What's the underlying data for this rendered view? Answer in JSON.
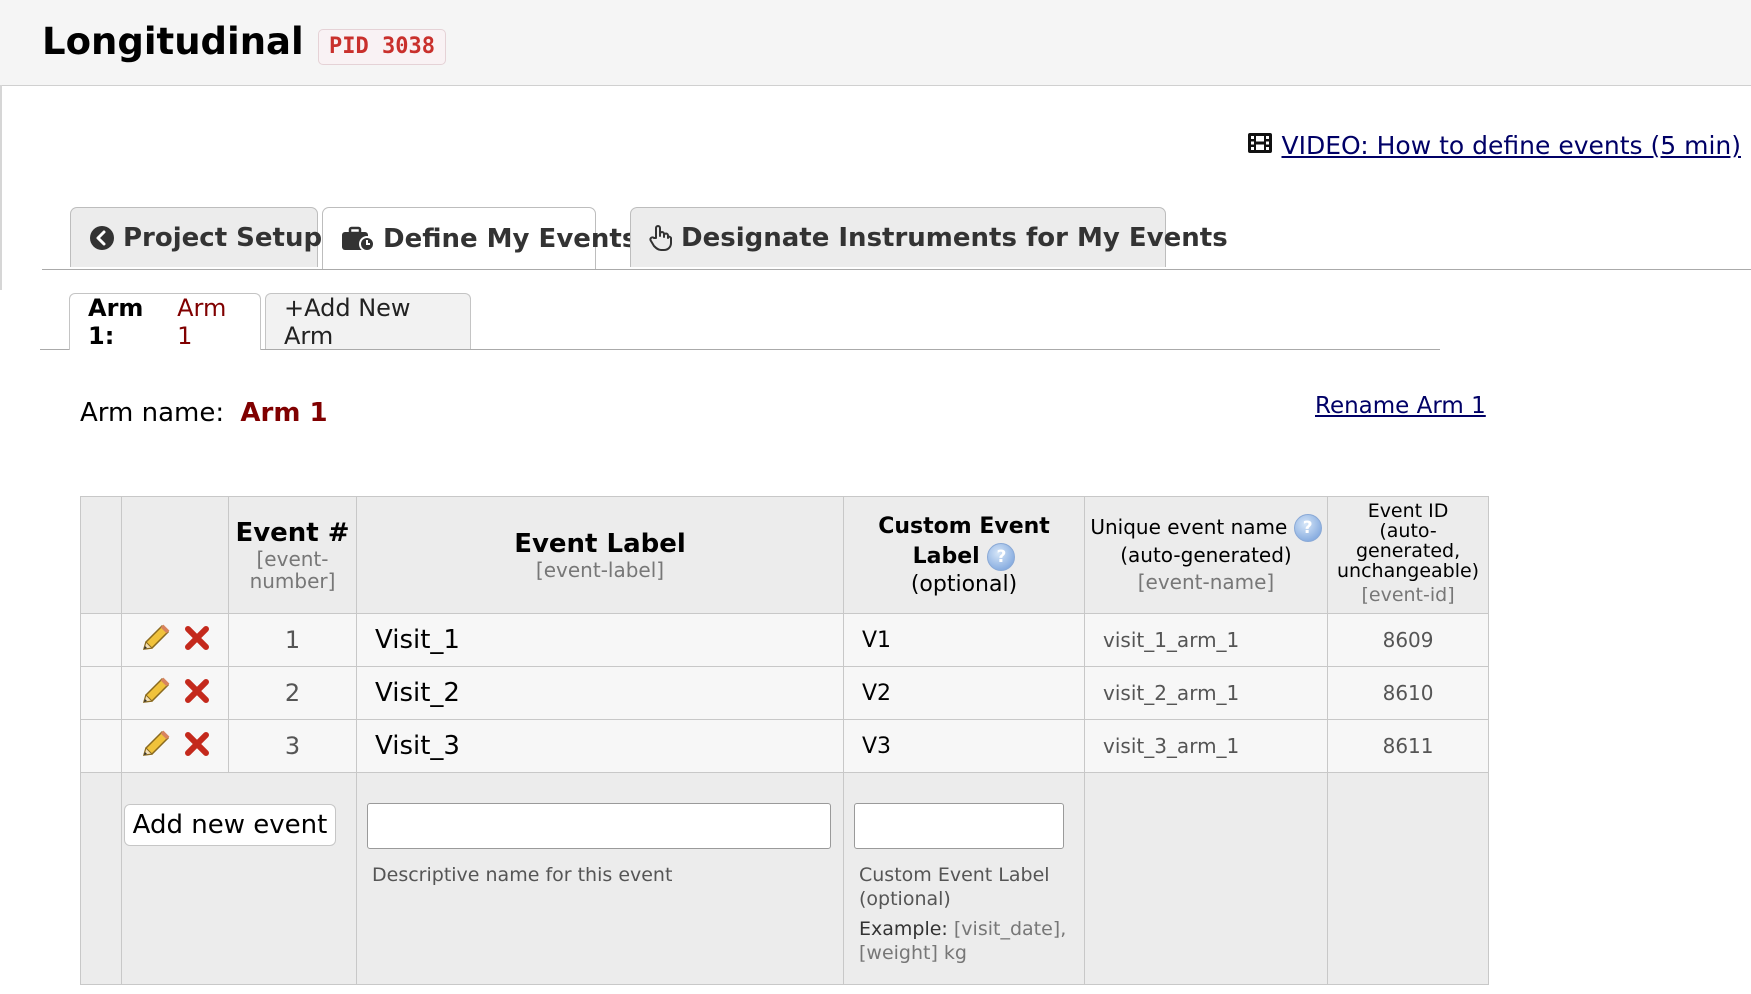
{
  "header": {
    "title": "Longitudinal",
    "pid": "PID 3038"
  },
  "video_link": {
    "icon": "film-icon",
    "label": "VIDEO: How to define events (5 min)"
  },
  "main_tabs": [
    {
      "icon": "circle-chevron-left-icon",
      "label": "Project Setup",
      "active": false
    },
    {
      "icon": "briefcase-clock-icon",
      "label": "Define My Events",
      "active": true
    },
    {
      "icon": "hand-pointer-icon",
      "label": "Designate Instruments for My Events",
      "active": false
    }
  ],
  "arm_tabs": {
    "active_prefix": "Arm 1:",
    "active_name": "Arm 1",
    "add_label": "+Add New Arm"
  },
  "arm": {
    "label": "Arm name:",
    "name": "Arm 1",
    "rename_label": "Rename Arm 1"
  },
  "table": {
    "headers": {
      "event_num": "Event #",
      "event_num_var": "[event-number]",
      "event_label": "Event Label",
      "event_label_var": "[event-label]",
      "custom_label": "Custom Event Label",
      "custom_optional": "(optional)",
      "unique_name": "Unique event name",
      "unique_auto": "(auto-generated)",
      "unique_var": "[event-name]",
      "event_id": "Event ID (auto-generated, unchangeable)",
      "event_id_var": "[event-id]"
    },
    "rows": [
      {
        "num": "1",
        "label": "Visit_1",
        "custom": "V1",
        "unique": "visit_1_arm_1",
        "id": "8609"
      },
      {
        "num": "2",
        "label": "Visit_2",
        "custom": "V2",
        "unique": "visit_2_arm_1",
        "id": "8610"
      },
      {
        "num": "3",
        "label": "Visit_3",
        "custom": "V3",
        "unique": "visit_3_arm_1",
        "id": "8611"
      }
    ],
    "add_row": {
      "button_label": "Add new event",
      "label_value": "",
      "label_hint": "Descriptive name for this event",
      "custom_value": "",
      "custom_hint": "Custom Event Label (optional)",
      "example_prefix": "Example:",
      "example_text": "[visit_date], [weight] kg"
    }
  },
  "colors": {
    "accent_dark_red": "#800000",
    "link": "#000066",
    "pid": "#c9302c"
  }
}
